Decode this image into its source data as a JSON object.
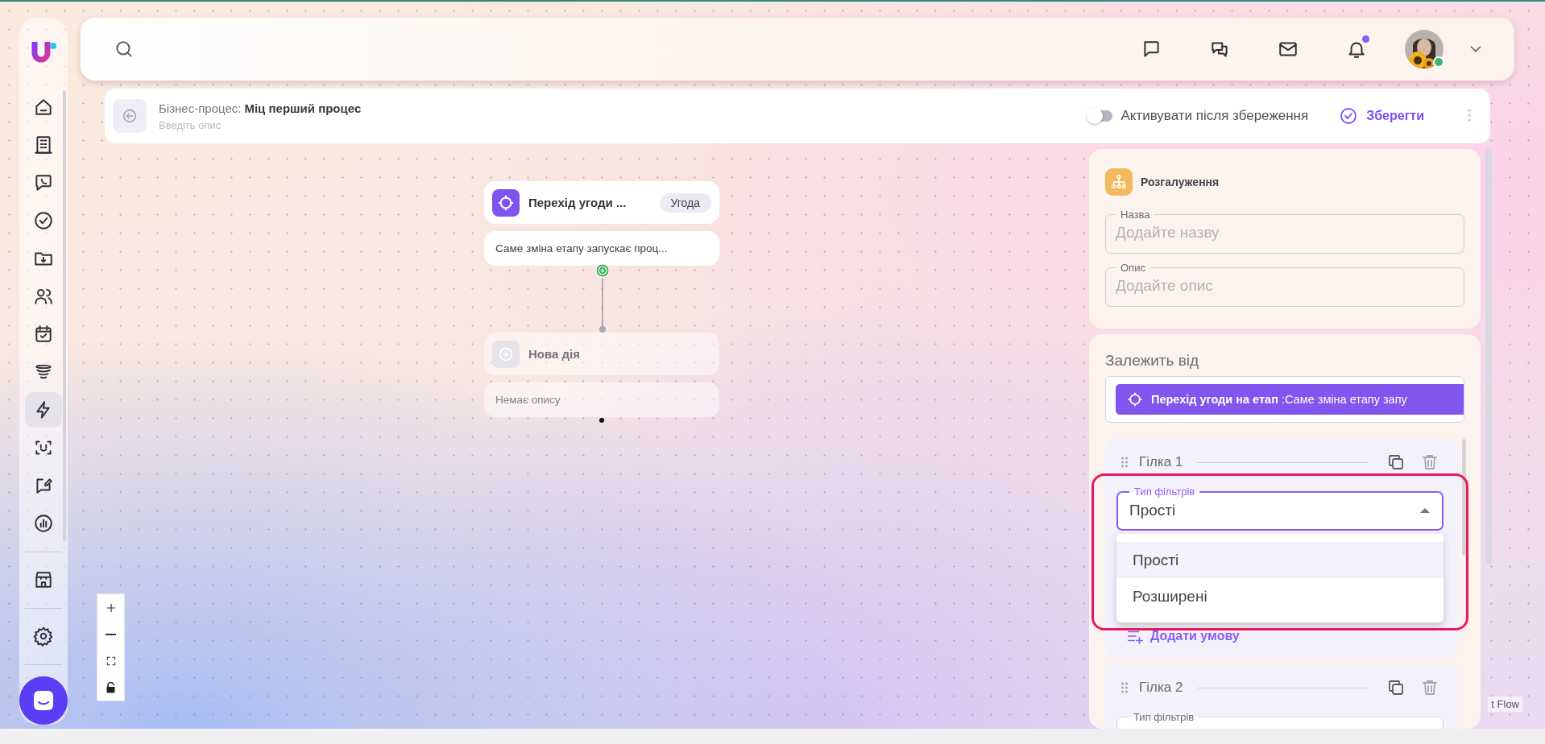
{
  "sidebar": {
    "sections": [
      {
        "items": [
          {
            "selected": false
          },
          {
            "selected": false
          },
          {
            "selected": false
          },
          {
            "selected": false
          },
          {
            "selected": false
          },
          {
            "selected": false
          },
          {
            "selected": false
          },
          {
            "selected": false
          },
          {
            "selected": true
          },
          {
            "selected": false
          },
          {
            "selected": false
          },
          {
            "selected": false
          }
        ]
      },
      {
        "items": [
          {
            "selected": false
          }
        ]
      },
      {
        "items": [
          {
            "selected": false
          }
        ]
      }
    ]
  },
  "top_bar": {
    "notifications": {
      "unread": true
    },
    "user": {
      "online": true
    }
  },
  "header": {
    "title_label": "Бізнес-процес:",
    "title": "Міц перший процес",
    "description_placeholder": "Введіть опис",
    "activate_toggle": {
      "label": "Активувати після збереження",
      "on": false
    },
    "save_button": "Зберегти"
  },
  "canvas": {
    "nodes": [
      {
        "kind": "trigger",
        "title": "Перехід угоди ...",
        "badge": "Угода",
        "description": "Саме зміна етапу запускає проц..."
      },
      {
        "kind": "placeholder",
        "title": "Нова дія",
        "description": "Немає опису"
      }
    ],
    "attribution": "t Flow"
  },
  "panel": {
    "title": "Розгалуження",
    "fields": [
      {
        "label": "Назва",
        "placeholder": "Додайте назву"
      },
      {
        "label": "Опис",
        "placeholder": "Додайте опис"
      }
    ],
    "depends_label": "Залежить від",
    "dependency_chip": "**Перехід угоди на етап** :Саме зміна етапу запу",
    "highlighted": true,
    "branches": [
      {
        "title": "Гілка 1",
        "filter": {
          "label": "Тип фільтрів",
          "value": "Прості",
          "open": true,
          "options": [
            {
              "label": "Прості",
              "selected": true
            },
            {
              "label": "Розширені",
              "selected": false
            }
          ]
        },
        "add_condition": "Додати умову"
      },
      {
        "title": "Гілка 2",
        "filter": {
          "label": "Тип фільтрів",
          "open": false
        }
      }
    ]
  }
}
